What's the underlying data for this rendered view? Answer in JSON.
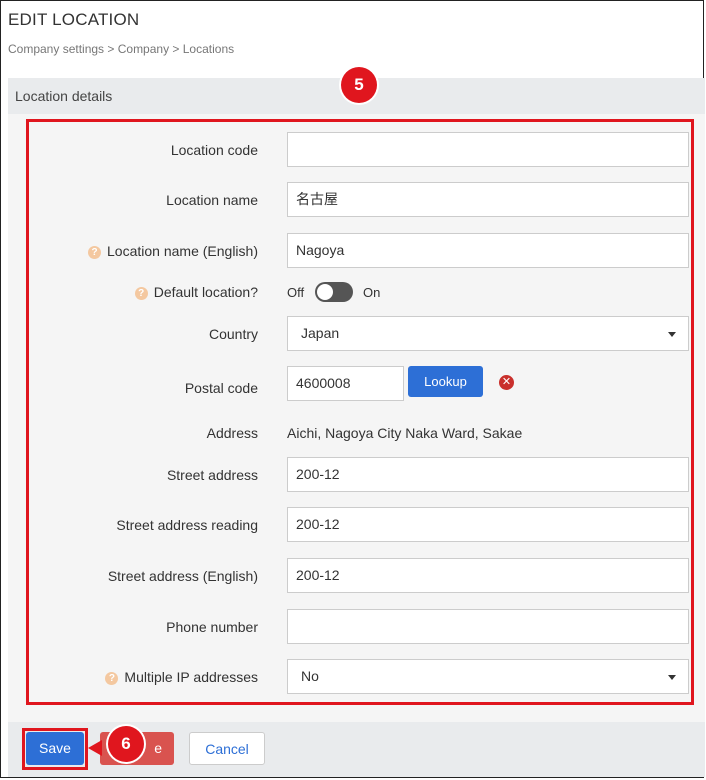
{
  "page": {
    "title": "EDIT LOCATION",
    "breadcrumb": "Company settings > Company > Locations",
    "section_title": "Location details"
  },
  "callouts": {
    "step5": "5",
    "step6": "6"
  },
  "form": {
    "location_code": {
      "label": "Location code",
      "value": ""
    },
    "location_name": {
      "label": "Location name",
      "value": "名古屋"
    },
    "location_name_en": {
      "label": "Location name (English)",
      "value": "Nagoya"
    },
    "default_location": {
      "label": "Default location?",
      "off_label": "Off",
      "on_label": "On",
      "state": "off"
    },
    "country": {
      "label": "Country",
      "value": "Japan"
    },
    "postal_code": {
      "label": "Postal code",
      "value": "4600008",
      "lookup_label": "Lookup"
    },
    "address": {
      "label": "Address",
      "value": "Aichi, Nagoya City Naka Ward, Sakae"
    },
    "street_address": {
      "label": "Street address",
      "value": "200-12"
    },
    "street_address_reading": {
      "label": "Street address reading",
      "value": "200-12"
    },
    "street_address_en": {
      "label": "Street address (English)",
      "value": "200-12"
    },
    "phone_number": {
      "label": "Phone number",
      "value": ""
    },
    "multiple_ip": {
      "label": "Multiple IP addresses",
      "value": "No"
    }
  },
  "footer": {
    "save_label": "Save",
    "delete_label": "e",
    "cancel_label": "Cancel"
  },
  "icons": {
    "help": "help-icon",
    "clear": "clear-icon",
    "caret": "chevron-down-icon"
  },
  "colors": {
    "primary": "#2d6fd6",
    "danger": "#d9534f",
    "annotation": "#e0161e"
  }
}
